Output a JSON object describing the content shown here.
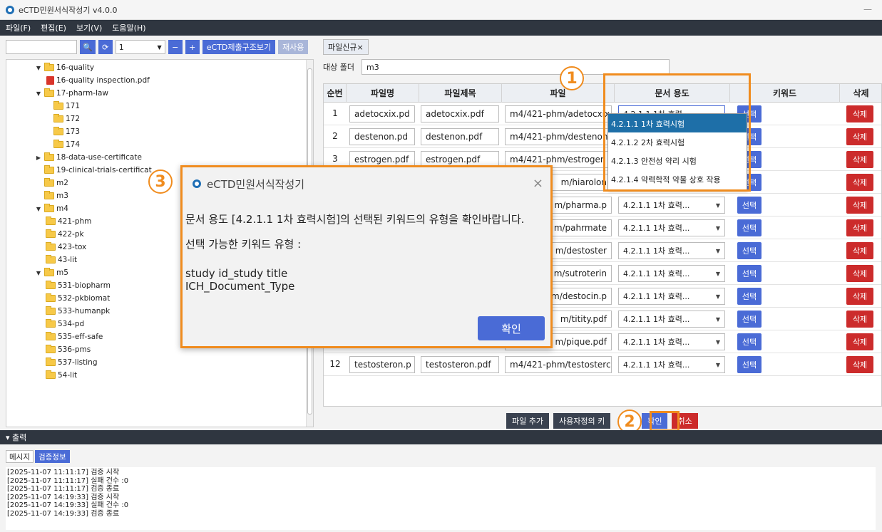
{
  "window": {
    "title": "eCTD민원서식작성기 v4.0.0",
    "minimize": "—"
  },
  "menu": [
    "파일(F)",
    "편집(E)",
    "보기(V)",
    "도움말(H)"
  ],
  "toolbar": {
    "search_icon": "🔍",
    "refresh_icon": "⟳",
    "select_value": "1",
    "select_arrow": "▼",
    "minus": "−",
    "plus": "+",
    "structure_label": "eCTD제출구조보기",
    "reuse_label": "재사용"
  },
  "tree": {
    "items": [
      {
        "label": "16-quality",
        "caret": "▼",
        "icon": "folder"
      },
      {
        "label": "16-quality inspection.pdf",
        "caret": "",
        "icon": "pdf"
      },
      {
        "label": "17-pharm-law",
        "caret": "▼",
        "icon": "folder"
      },
      {
        "label": "171",
        "caret": "",
        "icon": "folder"
      },
      {
        "label": "172",
        "caret": "",
        "icon": "folder"
      },
      {
        "label": "173",
        "caret": "",
        "icon": "folder"
      },
      {
        "label": "174",
        "caret": "",
        "icon": "folder"
      },
      {
        "label": "18-data-use-certificate",
        "caret": "▶",
        "icon": "folder"
      },
      {
        "label": "19-clinical-trials-certificat",
        "caret": "",
        "icon": "folder"
      },
      {
        "label": "m2",
        "caret": "",
        "icon": "folder"
      },
      {
        "label": "m3",
        "caret": "",
        "icon": "folder"
      },
      {
        "label": "m4",
        "caret": "▼",
        "icon": "folder"
      },
      {
        "label": "421-phm",
        "caret": "",
        "icon": "folder"
      },
      {
        "label": "422-pk",
        "caret": "",
        "icon": "folder"
      },
      {
        "label": "423-tox",
        "caret": "",
        "icon": "folder"
      },
      {
        "label": "43-lit",
        "caret": "",
        "icon": "folder"
      },
      {
        "label": "m5",
        "caret": "▼",
        "icon": "folder"
      },
      {
        "label": "531-biopharm",
        "caret": "",
        "icon": "folder"
      },
      {
        "label": "532-pkbiomat",
        "caret": "",
        "icon": "folder"
      },
      {
        "label": "533-humanpk",
        "caret": "",
        "icon": "folder"
      },
      {
        "label": "534-pd",
        "caret": "",
        "icon": "folder"
      },
      {
        "label": "535-eff-safe",
        "caret": "",
        "icon": "folder"
      },
      {
        "label": "536-pms",
        "caret": "",
        "icon": "folder"
      },
      {
        "label": "537-listing",
        "caret": "",
        "icon": "folder"
      },
      {
        "label": "54-lit",
        "caret": "",
        "icon": "folder"
      }
    ]
  },
  "tab": {
    "label": "파일신규",
    "close": "×"
  },
  "target": {
    "label": "대상 폴더",
    "value": "m3"
  },
  "grid": {
    "headers": [
      "순번",
      "파일명",
      "파일제목",
      "파일",
      "문서 용도",
      "키워드",
      "삭제"
    ],
    "select_btn": "선택",
    "delete_btn": "삭제",
    "dropdown_value": "4.2.1.1 1차 효력...",
    "dropdown_value_first": "4.2.1.1 1차 효력",
    "rows": [
      {
        "num": "1",
        "name": "adetocxix.pd",
        "title": "adetocxix.pdf",
        "path": "m4/421-phm/adetocxix"
      },
      {
        "num": "2",
        "name": "destenon.pd",
        "title": "destenon.pdf",
        "path": "m4/421-phm/destenon"
      },
      {
        "num": "3",
        "name": "estrogen.pdf",
        "title": "estrogen.pdf",
        "path": "m4/421-phm/estrogen"
      },
      {
        "num": "",
        "name": "",
        "title": "",
        "path": "m/hiarolon"
      },
      {
        "num": "",
        "name": "",
        "title": "",
        "path": "m/pharma.p"
      },
      {
        "num": "",
        "name": "",
        "title": "",
        "path": "m/pahrmate"
      },
      {
        "num": "",
        "name": "",
        "title": "",
        "path": "m/destoster"
      },
      {
        "num": "",
        "name": "",
        "title": "",
        "path": "m/sutroterin"
      },
      {
        "num": "",
        "name": "",
        "title": "",
        "path": "m/destocin.p"
      },
      {
        "num": "",
        "name": "",
        "title": "",
        "path": "m/titity.pdf"
      },
      {
        "num": "",
        "name": "",
        "title": "",
        "path": "m/pique.pdf"
      },
      {
        "num": "12",
        "name": "testosteron.p",
        "title": "testosteron.pdf",
        "path": "m4/421-phm/testosterc"
      }
    ]
  },
  "dropdown_options": [
    "4.2.1.1 1차 효력시험",
    "4.2.1.2 2차 효력시험",
    "4.2.1.3 안전성 약리 시험",
    "4.2.1.4 약력학적 약물 상호 작용"
  ],
  "bottom_buttons": {
    "add_file": "파일 추가",
    "custom_keyword": "사용자정의 키",
    "confirm": "확인",
    "cancel": "취소"
  },
  "badges": {
    "one": "1",
    "two": "2",
    "three": "3"
  },
  "output": {
    "header": "▾ 출력",
    "tabs": [
      "메시지",
      "검증정보"
    ],
    "logs": [
      "[2025-11-07 11:11:17]  검증 시작",
      "[2025-11-07 11:11:17]  실패 건수 :0",
      "[2025-11-07 11:11:17]  검증 종료",
      "[2025-11-07 14:19:33]  검증 시작",
      "[2025-11-07 14:19:33]  실패 건수 :0",
      "[2025-11-07 14:19:33]  검증 종료"
    ]
  },
  "modal": {
    "title": "eCTD민원서식작성기",
    "close": "×",
    "message": "문서 용도 [4.2.1.1 1차 효력시험]의 선택된 키워드의 유형을 확인바랍니다.",
    "available_label": "선택 가능한 키워드 유형 :",
    "types_line1": "study id_study title",
    "types_line2": "ICH_Document_Type",
    "ok": "확인"
  },
  "colors": {
    "accent": "#4a6bd6",
    "danger": "#cc2b2b",
    "highlight": "#f08c1e",
    "dark": "#2f3640"
  }
}
